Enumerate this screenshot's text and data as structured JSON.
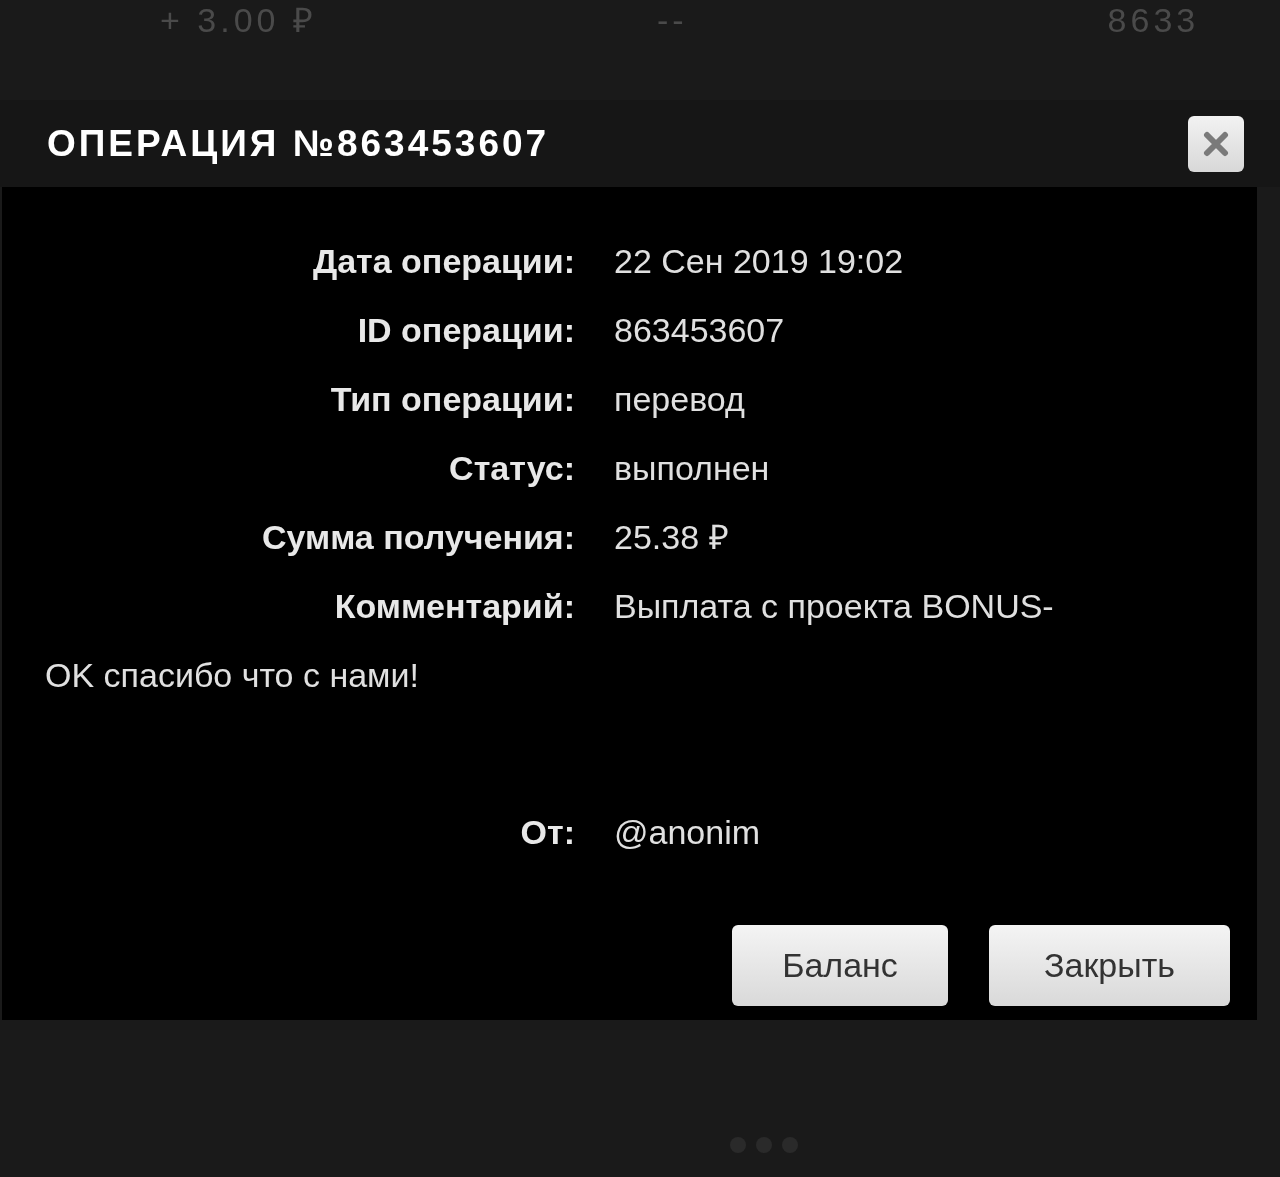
{
  "background": {
    "texts": [
      "+ 3.00 ₽",
      "--",
      "8633"
    ]
  },
  "dialog": {
    "title": "ОПЕРАЦИЯ №863453607",
    "fields": [
      {
        "label": "Дата операции:",
        "value": "22 Сен 2019 19:02"
      },
      {
        "label": "ID операции:",
        "value": "863453607"
      },
      {
        "label": "Тип операции:",
        "value": "перевод"
      },
      {
        "label": "Статус:",
        "value": "выполнен"
      },
      {
        "label": "Сумма получения:",
        "value": "25.38 ₽"
      },
      {
        "label": "Комментарий:",
        "value": "Выплата с проекта BONUS-",
        "continuation": "OK спасибо что с нами!"
      }
    ],
    "sender": {
      "label": "От:",
      "value": "@anonim"
    },
    "buttons": [
      "Баланс",
      "Закрыть"
    ]
  }
}
